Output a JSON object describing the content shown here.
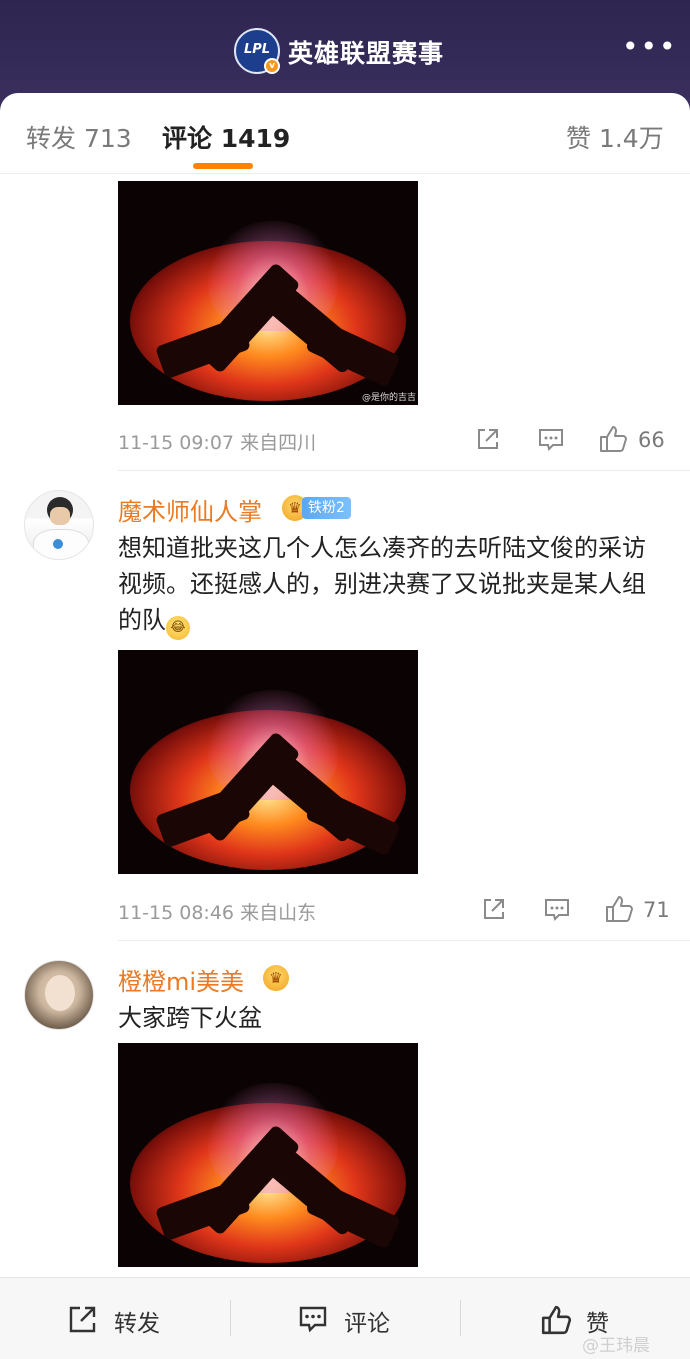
{
  "header": {
    "account_name": "英雄联盟赛事",
    "logo_text": "LPL",
    "verified_mark": "v",
    "more_label": "•••"
  },
  "tabs": [
    {
      "label": "转发 713"
    },
    {
      "label": "评论 1419"
    },
    {
      "label": "赞 1.4万"
    }
  ],
  "comments": [
    {
      "image_watermark": "@是你的吉吉",
      "time": "11-15 09:07",
      "location": "来自四川",
      "likes": "66"
    },
    {
      "username": "魔术师仙人掌",
      "fan_badge": "铁粉2",
      "text": "想知道批夹这几个人怎么凑齐的去听陆文俊的采访视频。还挺感人的，别进决赛了又说批夹是某人组的队",
      "time": "11-15 08:46",
      "location": "来自山东",
      "likes": "71"
    },
    {
      "username": "橙橙mi美美",
      "text": "大家跨下火盆"
    }
  ],
  "bottom_bar": {
    "repost": "转发",
    "comment": "评论",
    "like": "赞"
  },
  "watermark": "@王玮晨",
  "colors": {
    "header_bg": "#2e2550",
    "accent_orange": "#ff8200",
    "username_orange": "#eb7a22",
    "fan_badge_blue": "#5aa8f2"
  }
}
